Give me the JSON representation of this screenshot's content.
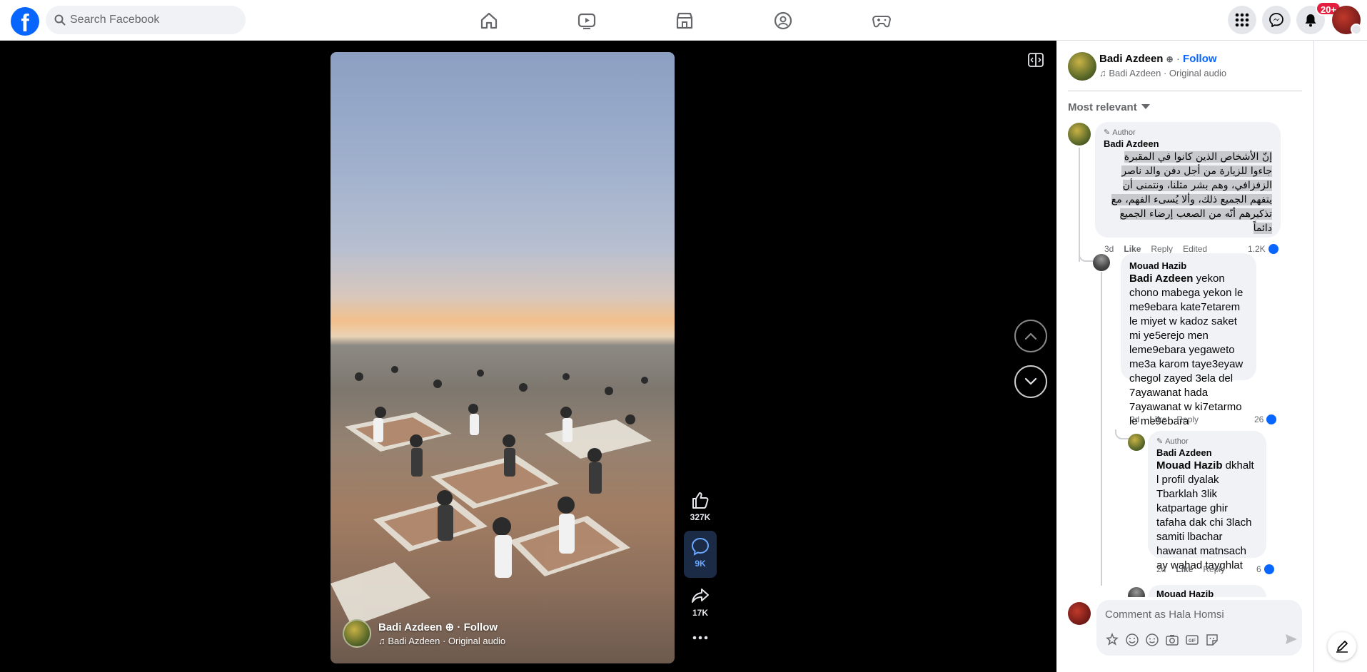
{
  "topbar": {
    "search_placeholder": "Search Facebook",
    "notification_badge": "20+",
    "nav": [
      "home-icon",
      "watch-icon",
      "marketplace-icon",
      "groups-icon",
      "gaming-icon"
    ],
    "accent": "#0866ff"
  },
  "video": {
    "author": "Badi Azdeen",
    "follow": "Follow",
    "audio": "Badi Azdeen · Original audio",
    "likes": "327K",
    "comments": "9K",
    "shares": "17K"
  },
  "panel": {
    "author": "Badi Azdeen",
    "follow": "Follow",
    "audio": "Badi Azdeen · Original audio",
    "sort_label": "Most relevant",
    "comments": [
      {
        "tag": "Author",
        "name": "Badi Azdeen",
        "text": "إنّ الأشخاص الذين كانوا في المقبرة جاءوا للزيارة من أجل دفن والد ناصر الزفزافي، وهم بشر مثلنا، ونتمنى أن يتفهم الجميع ذلك، وألا يُسىء الفهم، مع تذكيرهم أنّه من الصعب إرضاء الجميع دائماً",
        "time": "3d",
        "like": "Like",
        "reply": "Reply",
        "edited": "Edited",
        "reactions": "1.2K"
      },
      {
        "name": "Mouad Hazib",
        "mention": "Badi Azdeen",
        "text": " yekon chono mabega yekon le me9ebara kate7etarem le miyet w kadoz saket mi ye5erejo men leme9ebara yegaweto me3a karom taye3eyaw chegol zayed 3ela del 7ayawanat hada 7ayawanat w ki7etarmo le me9ebara",
        "time": "2d",
        "like": "Like",
        "reply": "Reply",
        "reactions": "26"
      },
      {
        "tag": "Author",
        "name": "Badi Azdeen",
        "mention": "Mouad Hazib",
        "text": " dkhalt l profil dyalak Tbarklah 3lik katpartage ghir tafaha dak chi 3lach samiti lbachar hawanat matnsach ay wahad tayghlat",
        "time": "2d",
        "like": "Like",
        "reply": "Reply",
        "reactions": "6"
      },
      {
        "name": "Mouad Hazib"
      }
    ],
    "composer_placeholder": "Comment as Hala Homsi"
  }
}
